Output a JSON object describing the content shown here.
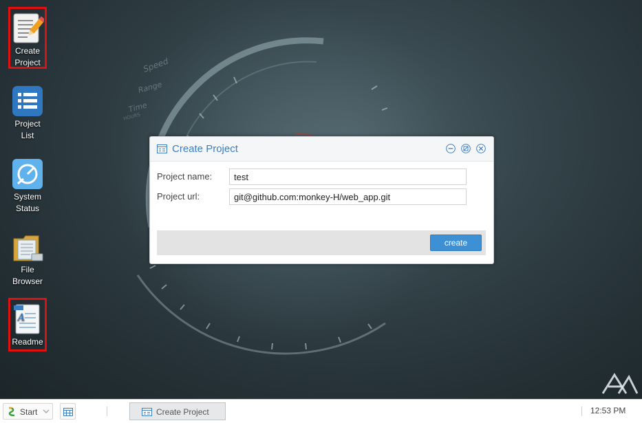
{
  "desktop": {
    "icons": [
      {
        "label_1": "Create",
        "label_2": "Project",
        "icon": "create-project-icon"
      },
      {
        "label_1": "Project",
        "label_2": "List",
        "icon": "project-list-icon"
      },
      {
        "label_1": "System",
        "label_2": "Status",
        "icon": "system-status-icon"
      },
      {
        "label_1": "File",
        "label_2": "Browser",
        "icon": "file-browser-icon"
      },
      {
        "label_1": "Readme",
        "icon": "readme-icon"
      }
    ],
    "wallpaper_text": [
      "Speed",
      "Range",
      "Time",
      "HOURS"
    ]
  },
  "dialog": {
    "title": "Create Project",
    "fields": [
      {
        "label": "Project name:",
        "value": "test"
      },
      {
        "label": "Project url:",
        "value": "git@github.com:monkey-H/web_app.git"
      }
    ],
    "create_label": "create"
  },
  "taskbar": {
    "start_label": "Start",
    "task_label": "Create Project",
    "clock": "12:53 PM"
  },
  "colors": {
    "accent": "#3d90d4",
    "title_blue": "#3a7dc0",
    "highlight_border": "#e01010"
  }
}
